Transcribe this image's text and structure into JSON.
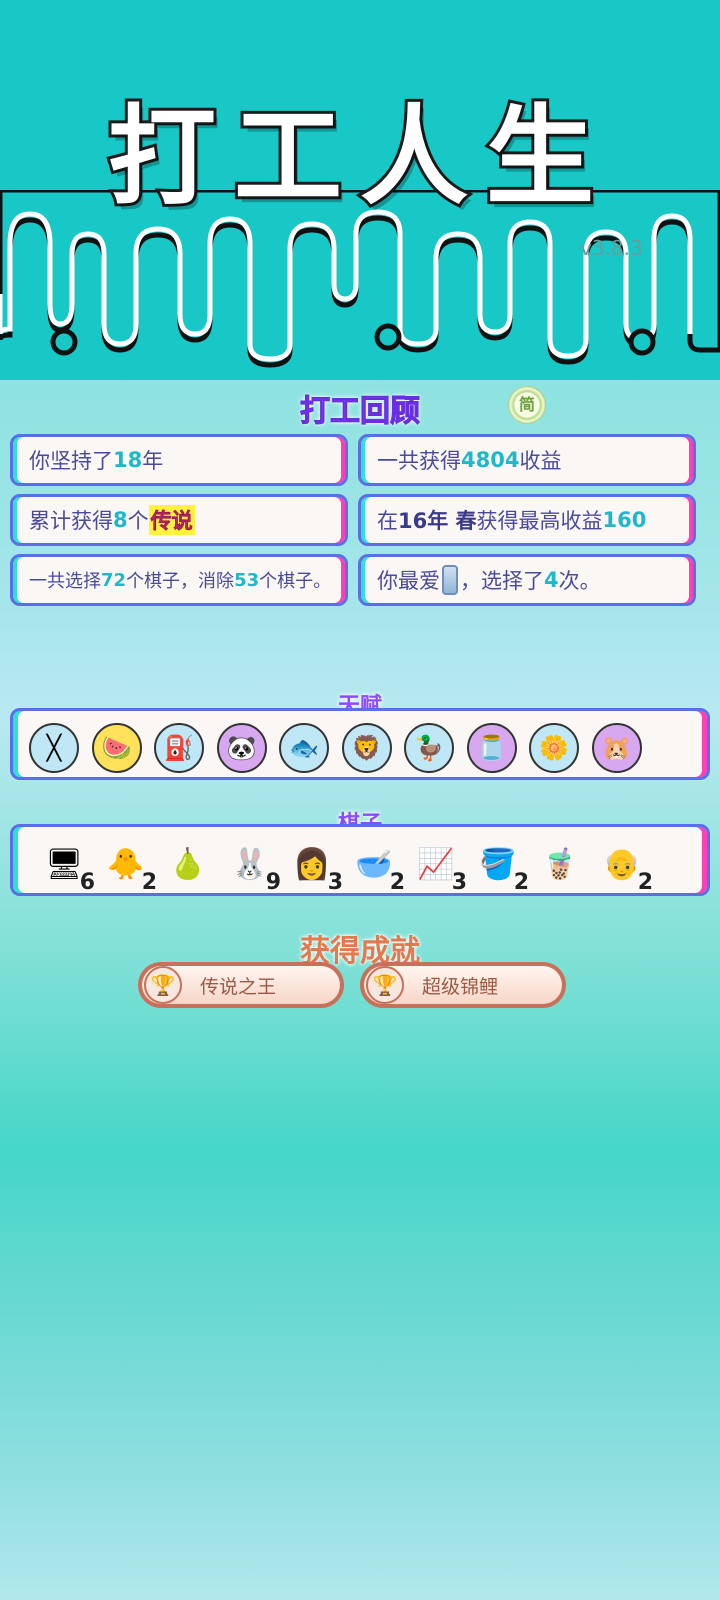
{
  "header": {
    "title": "打工人生",
    "version": "v3.8.3"
  },
  "review": {
    "title": "打工回顾",
    "simplify_label": "简",
    "stats": [
      {
        "pre": "你坚持了",
        "hl": "18",
        "post": "年"
      },
      {
        "pre": "一共获得",
        "hl": "4804",
        "post": "收益"
      },
      {
        "pre": "累计获得",
        "hl": "8",
        "mid": "个",
        "legend": "传说"
      },
      {
        "pre": "在 ",
        "bold1": "16年 春",
        "mid": " 获得最高收益",
        "hl": "160"
      },
      {
        "pre": "一共选择",
        "hl": "72",
        "mid": "个棋子，消除",
        "hl2": "53",
        "post": "个棋子。"
      },
      {
        "pre": "你最爱",
        "mid": "，选择了",
        "hl": "4",
        "post": "次。"
      }
    ]
  },
  "talents": {
    "title": "天赋",
    "items": [
      {
        "name": "chopsticks-icon",
        "glyph": "╳",
        "bg": "#bfe7f6"
      },
      {
        "name": "fruit-basket-icon",
        "glyph": "🍉",
        "bg": "#ffe15a"
      },
      {
        "name": "pump-icon",
        "glyph": "⛽",
        "bg": "#bfe7f6"
      },
      {
        "name": "panda-icon",
        "glyph": "🐼",
        "bg": "#d7a8f0"
      },
      {
        "name": "fish-tank-icon",
        "glyph": "🐟",
        "bg": "#bfe7f6"
      },
      {
        "name": "lion-icon",
        "glyph": "🦁",
        "bg": "#bfe7f6"
      },
      {
        "name": "cooker-duck-icon",
        "glyph": "🦆",
        "bg": "#bfe7f6"
      },
      {
        "name": "jar-icon",
        "glyph": "🫙",
        "bg": "#d7a8f0"
      },
      {
        "name": "flower-pot-icon",
        "glyph": "🌼",
        "bg": "#bfe7f6"
      },
      {
        "name": "hamsters-icon",
        "glyph": "🐹",
        "bg": "#d7a8f0"
      }
    ]
  },
  "pieces": {
    "title": "棋子",
    "items": [
      {
        "name": "computer-case-icon",
        "glyph": "🖥",
        "count": "6"
      },
      {
        "name": "chick-face-icon",
        "glyph": "🐥",
        "count": "2"
      },
      {
        "name": "longan-icon",
        "glyph": "🍐",
        "count": ""
      },
      {
        "name": "rabbit-icon",
        "glyph": "🐰",
        "count": "9"
      },
      {
        "name": "girl-face-icon",
        "glyph": "👩",
        "count": "3"
      },
      {
        "name": "bowl-icon",
        "glyph": "🥣",
        "count": "2"
      },
      {
        "name": "stock-chart-icon",
        "glyph": "📈",
        "count": "3"
      },
      {
        "name": "bucket-icon",
        "glyph": "🪣",
        "count": "2"
      },
      {
        "name": "bubble-tea-icon",
        "glyph": "🧋",
        "count": ""
      },
      {
        "name": "old-man-icon",
        "glyph": "👴",
        "count": "2"
      }
    ]
  },
  "achievements": {
    "title": "获得成就",
    "items": [
      {
        "label": "传说之王",
        "trophy": "🏆"
      },
      {
        "label": "超级锦鲤",
        "trophy": "🏆"
      }
    ]
  }
}
